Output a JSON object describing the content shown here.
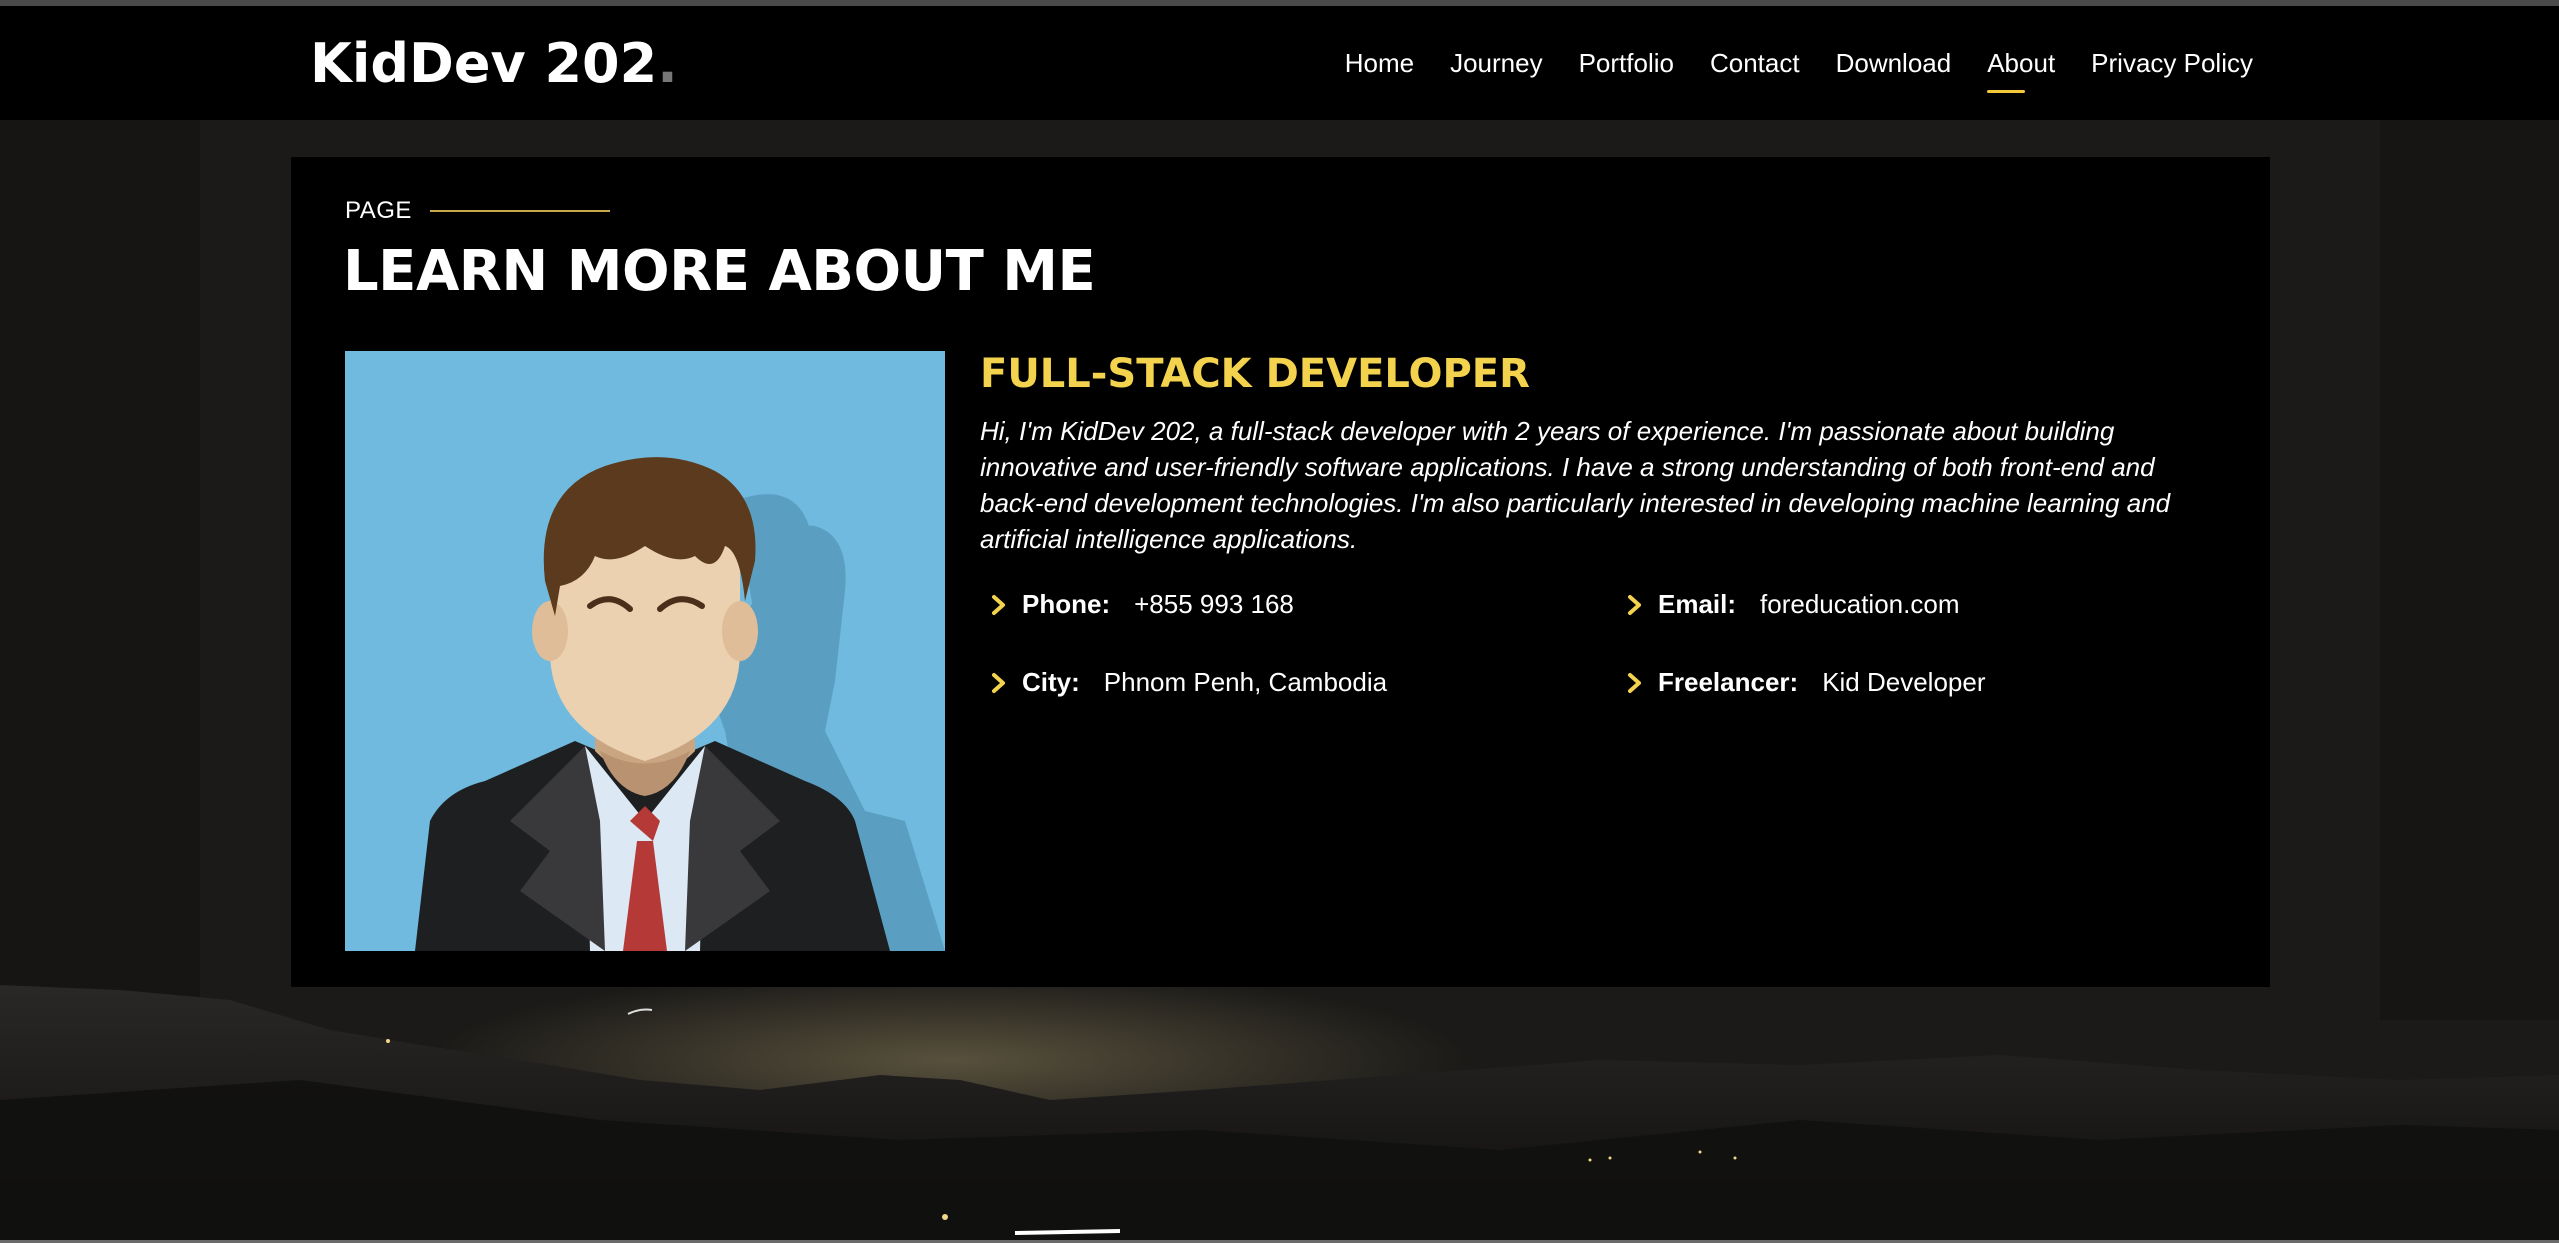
{
  "brand": {
    "logo_text": "KidDev 202",
    "accent_color": "#f3d24e"
  },
  "nav": {
    "items": [
      {
        "label": "Home",
        "active": false
      },
      {
        "label": "Journey",
        "active": false
      },
      {
        "label": "Portfolio",
        "active": false
      },
      {
        "label": "Contact",
        "active": false
      },
      {
        "label": "Download",
        "active": false
      },
      {
        "label": "About",
        "active": true
      },
      {
        "label": "Privacy Policy",
        "active": false
      }
    ]
  },
  "about": {
    "section_label": "PAGE",
    "title": "LEARN MORE ABOUT ME",
    "role": "FULL-STACK DEVELOPER",
    "bio": "Hi, I'm KidDev 202, a full-stack developer with 2 years of experience. I'm passionate about building innovative and user-friendly software applications. I have a strong understanding of both front-end and back-end development technologies. I'm also particularly interested in developing machine learning and artificial intelligence applications.",
    "details": {
      "phone": {
        "label": "Phone:",
        "value": "+855 993 168"
      },
      "email": {
        "label": "Email:",
        "value": "foreducation.com"
      },
      "city": {
        "label": "City:",
        "value": "Phnom Penh, Cambodia"
      },
      "freelancer": {
        "label": "Freelancer:",
        "value": "Kid Developer"
      }
    },
    "portrait_bg_color": "#6fbade"
  },
  "icons": {
    "detail_bullet": "chevron-right-icon"
  }
}
